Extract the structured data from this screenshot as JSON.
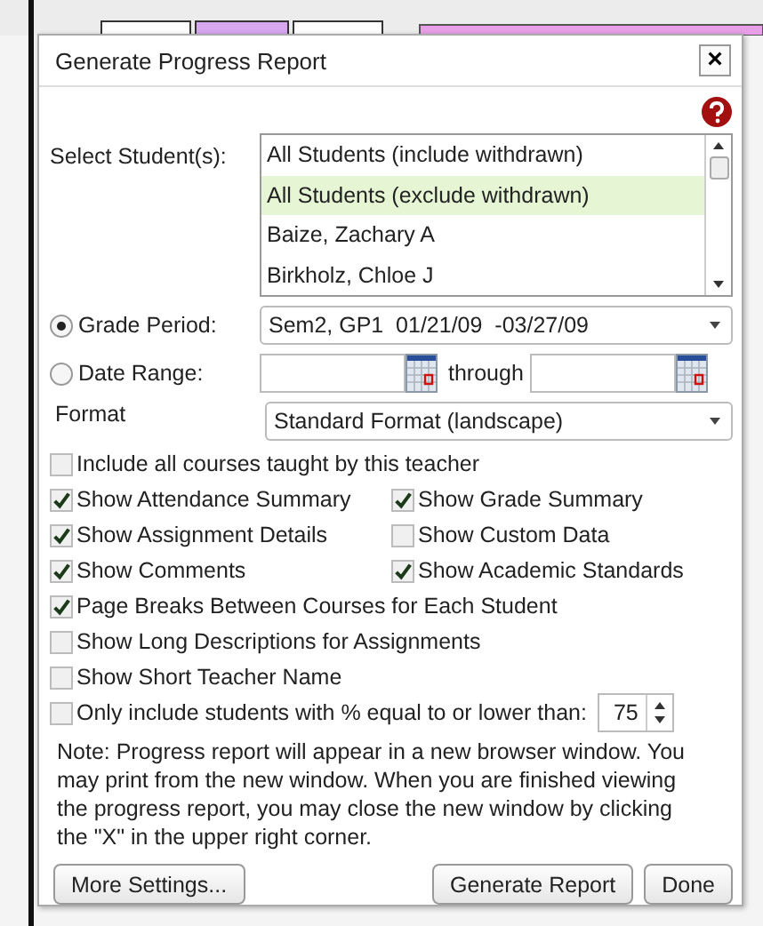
{
  "dialog": {
    "title": "Generate Progress Report",
    "close": "×"
  },
  "students": {
    "label": "Select Student(s):",
    "items": [
      {
        "name": "All Students (include withdrawn)",
        "selected": false
      },
      {
        "name": "All Students (exclude withdrawn)",
        "selected": true
      },
      {
        "name": "Baize, Zachary A",
        "selected": false
      },
      {
        "name": "Birkholz, Chloe J",
        "selected": false
      }
    ]
  },
  "period_options": [
    {
      "kind": "select",
      "label": "Grade Period:",
      "selected": true,
      "value": "Sem2, GP1  01/21/09  -03/27/09"
    },
    {
      "kind": "dates",
      "label": "Date Range:",
      "selected": false,
      "connector": "through"
    }
  ],
  "format": {
    "label": "Format",
    "value": "Standard Format (landscape)"
  },
  "option_rows": [
    [
      {
        "label": "Include all courses taught by this teacher",
        "checked": false
      }
    ],
    [
      {
        "label": "Show Attendance Summary",
        "checked": true
      },
      {
        "label": "Show Grade Summary",
        "checked": true
      }
    ],
    [
      {
        "label": "Show Assignment Details",
        "checked": true
      },
      {
        "label": "Show Custom Data",
        "checked": false
      }
    ],
    [
      {
        "label": "Show Comments",
        "checked": true
      },
      {
        "label": "Show Academic Standards",
        "checked": true
      }
    ],
    [
      {
        "label": "Page Breaks Between Courses for Each Student",
        "checked": true
      }
    ],
    [
      {
        "label": "Show Long Descriptions for Assignments",
        "checked": false
      }
    ],
    [
      {
        "label": "Show Short Teacher Name",
        "checked": false
      }
    ]
  ],
  "threshold": {
    "label": "Only include students with % equal to or lower than:",
    "checked": false,
    "value": "75"
  },
  "note": "Note: Progress report will appear in a new browser window. You may print from the new window. When you are finished viewing the progress report, you may close the new window by clicking the \"X\" in the upper right corner.",
  "left_buttons": [
    "More Settings..."
  ],
  "right_buttons": [
    "Generate Report",
    "Done"
  ]
}
